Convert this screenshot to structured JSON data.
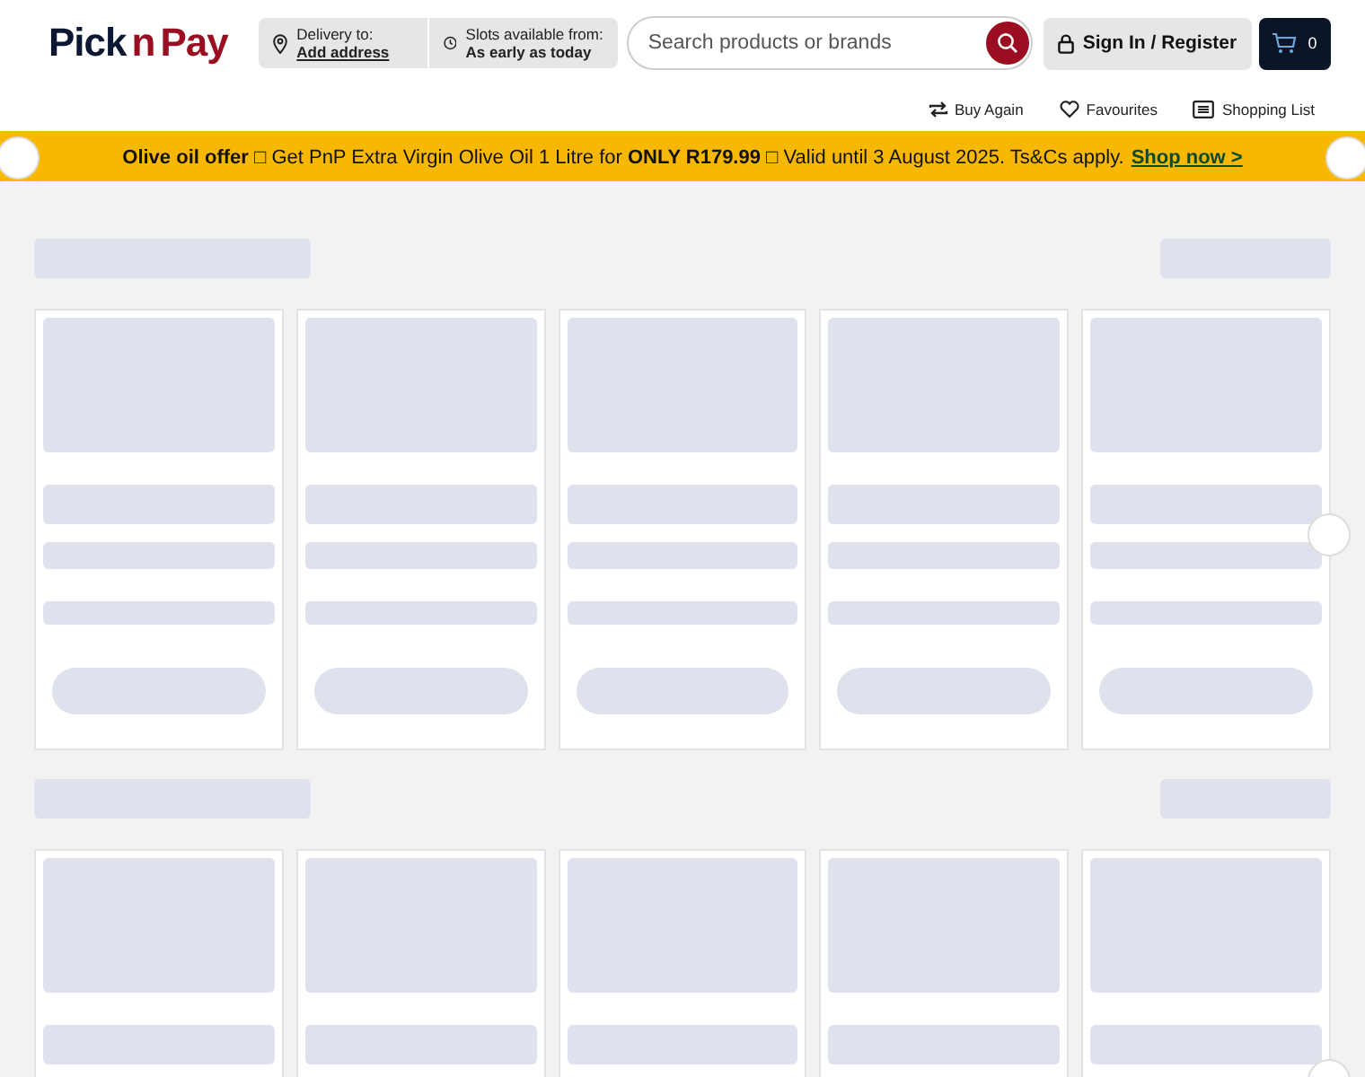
{
  "header": {
    "logo": {
      "dark": "Pick",
      "red_n": "n",
      "red": "Pay"
    },
    "delivery": {
      "label": "Delivery to:",
      "link": "Add address"
    },
    "slots": {
      "label": "Slots available from:",
      "value": "As early as today"
    },
    "search": {
      "placeholder": "Search products or brands"
    },
    "sign_in": "Sign In / Register",
    "cart": {
      "count": "0"
    }
  },
  "quick_links": [
    {
      "label": "Buy Again",
      "kind": "repeat"
    },
    {
      "label": "Favourites",
      "kind": "heart"
    },
    {
      "label": "Shopping List",
      "kind": "list"
    }
  ],
  "promo_banner": {
    "text": "**Olive oil offer** □ Get PnP Extra Virgin Olive Oil 1 Litre for **ONLY R179.99** □ Valid until 3 August 2025. Ts&Cs apply.",
    "link": "Shop now >"
  }
}
